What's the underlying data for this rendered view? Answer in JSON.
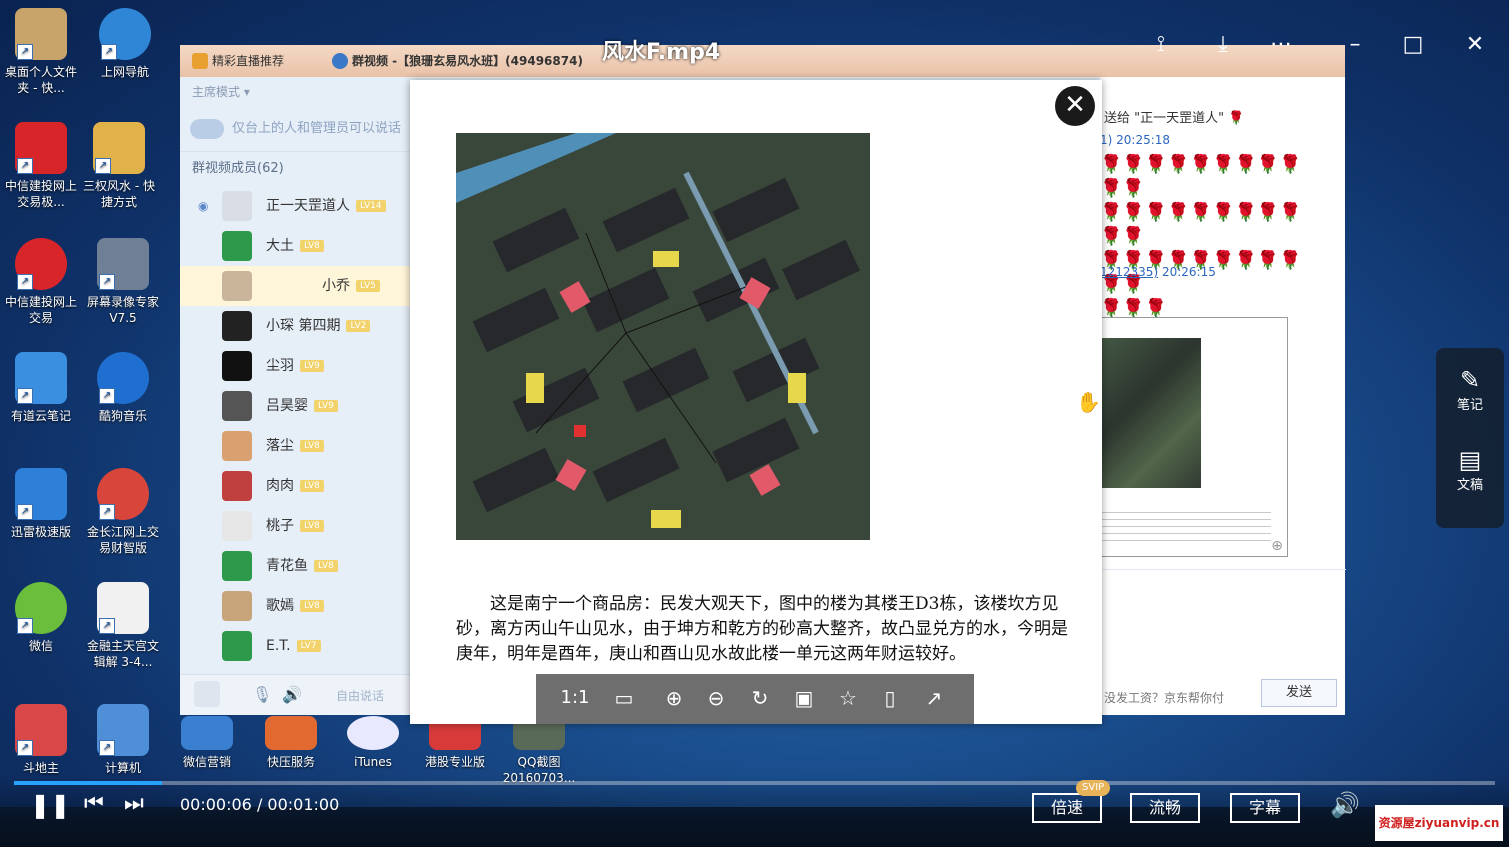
{
  "player": {
    "title": "风水F.mp4",
    "time_current": "00:00:06",
    "time_total": "00:01:00",
    "progress": 0.1,
    "speed_label": "倍速",
    "speed_badge": "SVIP",
    "quality_label": "流畅",
    "subtitle_label": "字幕",
    "side_panel": {
      "notes_label": "笔记",
      "doc_label": "文稿"
    }
  },
  "desktop_icons": [
    {
      "label": "桌面个人文件夹 - 快...",
      "color": "#c8a46a"
    },
    {
      "label": "上网导航",
      "color": "#2f86d6"
    },
    {
      "label": "中信建投网上交易极...",
      "color": "#d8252a"
    },
    {
      "label": "三权风水 - 快捷方式",
      "color": "#e2b24a"
    },
    {
      "label": "中信建投网上交易",
      "color": "#d8252a"
    },
    {
      "label": "屏幕录像专家V7.5",
      "color": "#6f7f96"
    },
    {
      "label": "有道云笔记",
      "color": "#3b8fe0"
    },
    {
      "label": "酷狗音乐",
      "color": "#1f6fd0"
    },
    {
      "label": "迅雷极速版",
      "color": "#2d7fd8"
    },
    {
      "label": "金长江网上交易财智版",
      "color": "#d8453a"
    },
    {
      "label": "微信",
      "color": "#6abe3c"
    },
    {
      "label": "金融主天宫文辑解 3-4...",
      "color": "#f1f1f1"
    },
    {
      "label": "斗地主",
      "color": "#d84848"
    },
    {
      "label": "计算机",
      "color": "#4f8fd8"
    }
  ],
  "taskbar_labels": [
    "微信营销",
    "快压服务",
    "iTunes",
    "港股专业版",
    "QQ截图20160703..."
  ],
  "qq": {
    "tab1": "精彩直播推荐",
    "tab2": "群视频 -【狼珊玄易风水班】(49496874)",
    "mode": "主席模式 ▾",
    "notice": "仅台上的人和管理员可以说话",
    "member_count": "群视频成员(62)",
    "members": [
      {
        "name": "正一天罡道人",
        "lv": "LV14",
        "color": "#d8dde6"
      },
      {
        "name": "大土",
        "lv": "LV8",
        "color": "#2c9a4a"
      },
      {
        "name": "小乔",
        "lv": "LV5",
        "color": "#c9b59a"
      },
      {
        "name": "小琛 第四期",
        "lv": "LV2",
        "color": "#222222"
      },
      {
        "name": "尘羽",
        "lv": "LV9",
        "color": "#111111"
      },
      {
        "name": "吕昊婴",
        "lv": "LV9",
        "color": "#555555"
      },
      {
        "name": "落尘",
        "lv": "LV8",
        "color": "#d9a070"
      },
      {
        "name": "肉肉",
        "lv": "LV8",
        "color": "#c04040"
      },
      {
        "name": "桃子",
        "lv": "LV8",
        "color": "#e6e6e6"
      },
      {
        "name": "青花鱼",
        "lv": "LV8",
        "color": "#2c9a4a"
      },
      {
        "name": "歌嫣",
        "lv": "LV8",
        "color": "#c8a47a"
      },
      {
        "name": "E.T.",
        "lv": "LV7",
        "color": "#2c9a4a"
      }
    ],
    "free_talk": "自由说话",
    "chat_gift": "送给 \"正一天罡道人\"",
    "chat_time1": "1)  20:25:18",
    "chat_user2": "1212335)",
    "chat_time2": "20:26:15",
    "ad_text": "没发工资？京东帮你付",
    "send_label": "发送"
  },
  "viewer": {
    "close_label": "✕",
    "caption": "这是南宁一个商品房：民发大观天下，图中的楼为其楼王D3栋，该楼坎方见砂，离方丙山午山见水，由于坤方和乾方的砂高大整齐，故凸显兑方的水，今明是庚年，明年是酉年，庚山和酉山见水故此楼一单元这两年财运较好。",
    "toolbar": [
      "1:1",
      "适应",
      "放大",
      "缩小",
      "旋转",
      "保存",
      "收藏",
      "屏幕",
      "分享"
    ]
  },
  "watermark": "资源屋ziyuanvip.cn"
}
